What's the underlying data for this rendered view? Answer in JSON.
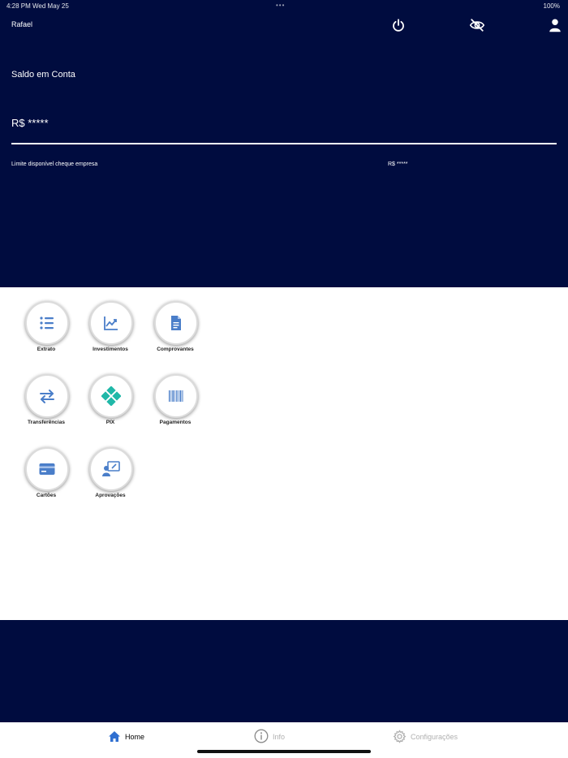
{
  "status_bar": {
    "time": "4:28 PM   Wed May 25",
    "dots": "•••",
    "battery": "100%"
  },
  "header": {
    "user_name": "Rafael",
    "icons": [
      "power-icon",
      "eye-off-icon",
      "user-icon"
    ],
    "balance_label": "Saldo em Conta",
    "balance_value": "R$ *****",
    "limit_label": "Limite disponível cheque empresa",
    "limit_value": "R$ *****",
    "background_color": "#000c3f"
  },
  "menu": {
    "items": [
      {
        "label": "Extrato",
        "icon": "list-icon"
      },
      {
        "label": "Investimentos",
        "icon": "chart-icon"
      },
      {
        "label": "Comprovantes",
        "icon": "document-icon"
      },
      {
        "label": "Transferências",
        "icon": "transfer-icon"
      },
      {
        "label": "PIX",
        "icon": "pix-icon"
      },
      {
        "label": "Pagamentos",
        "icon": "barcode-icon"
      },
      {
        "label": "Cartões",
        "icon": "card-icon"
      },
      {
        "label": "Aprovações",
        "icon": "approval-icon"
      }
    ]
  },
  "tabbar": {
    "tabs": [
      {
        "label": "Home",
        "icon": "home-icon",
        "active": true
      },
      {
        "label": "Info",
        "icon": "info-icon",
        "active": false
      },
      {
        "label": "Configurações",
        "icon": "gear-icon",
        "active": false
      }
    ],
    "active_color": "#2f6fd0",
    "inactive_color": "#b0b0b0"
  }
}
